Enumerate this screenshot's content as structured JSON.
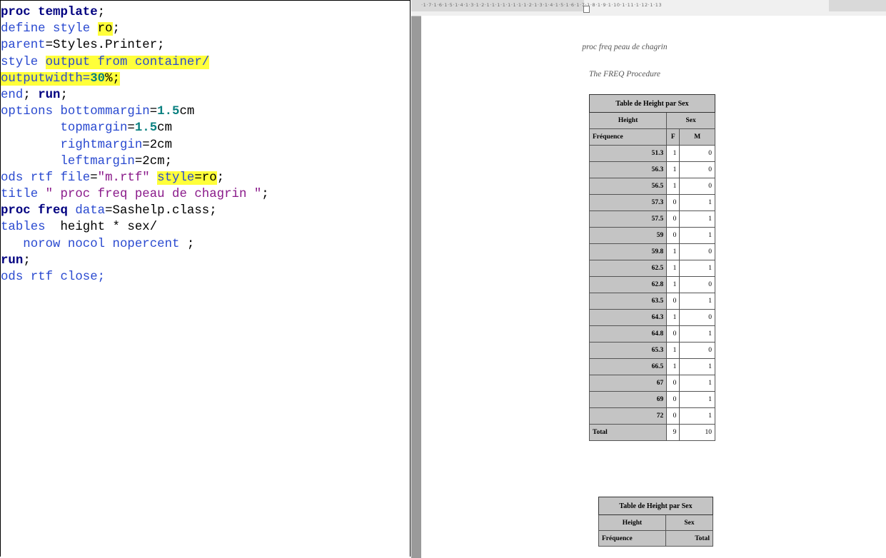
{
  "code": {
    "lines": [
      [
        {
          "t": "proc template",
          "c": "kw"
        },
        {
          "t": ";",
          "c": "bk"
        }
      ],
      [
        {
          "t": "define style ",
          "c": "bl"
        },
        {
          "t": "ro",
          "c": "bk hl"
        },
        {
          "t": ";",
          "c": "bk"
        }
      ],
      [
        {
          "t": "parent",
          "c": "bl"
        },
        {
          "t": "=Styles.Printer;",
          "c": "bk"
        }
      ],
      [
        {
          "t": "style ",
          "c": "bl"
        },
        {
          "t": "output from container/",
          "c": "bl hl"
        }
      ],
      [
        {
          "t": "outputwidth=",
          "c": "bl hl"
        },
        {
          "t": "30",
          "c": "nm hl"
        },
        {
          "t": "%;",
          "c": "bk hl"
        }
      ],
      [
        {
          "t": "end",
          "c": "bl"
        },
        {
          "t": "; ",
          "c": "bk"
        },
        {
          "t": "run",
          "c": "kw"
        },
        {
          "t": ";",
          "c": "bk"
        }
      ],
      [
        {
          "t": "options bottommargin",
          "c": "bl"
        },
        {
          "t": "=",
          "c": "bk"
        },
        {
          "t": "1.5",
          "c": "nm"
        },
        {
          "t": "cm",
          "c": "bk"
        }
      ],
      [
        {
          "t": "        topmargin",
          "c": "bl"
        },
        {
          "t": "=",
          "c": "bk"
        },
        {
          "t": "1.5",
          "c": "nm"
        },
        {
          "t": "cm",
          "c": "bk"
        }
      ],
      [
        {
          "t": "        rightmargin",
          "c": "bl"
        },
        {
          "t": "=2cm",
          "c": "bk"
        }
      ],
      [
        {
          "t": "        leftmargin",
          "c": "bl"
        },
        {
          "t": "=2cm;",
          "c": "bk"
        }
      ],
      [
        {
          "t": "ods rtf file",
          "c": "bl"
        },
        {
          "t": "=",
          "c": "bk"
        },
        {
          "t": "\"m.rtf\"",
          "c": "pu"
        },
        {
          "t": " ",
          "c": "bk"
        },
        {
          "t": "style",
          "c": "bl hl"
        },
        {
          "t": "=ro",
          "c": "bk hl"
        },
        {
          "t": ";",
          "c": "bk"
        }
      ],
      [
        {
          "t": "title ",
          "c": "bl"
        },
        {
          "t": "\" proc freq peau de chagrin \"",
          "c": "pu"
        },
        {
          "t": ";",
          "c": "bk"
        }
      ],
      [
        {
          "t": "proc freq",
          "c": "kw"
        },
        {
          "t": " data",
          "c": "bl"
        },
        {
          "t": "=Sashelp.class;",
          "c": "bk"
        }
      ],
      [
        {
          "t": "tables ",
          "c": "bl"
        },
        {
          "t": " height * sex/",
          "c": "bk"
        }
      ],
      [
        {
          "t": "   norow nocol nopercent ",
          "c": "bl"
        },
        {
          "t": ";",
          "c": "bk"
        }
      ],
      [
        {
          "t": "run",
          "c": "kw"
        },
        {
          "t": ";",
          "c": "bk"
        }
      ],
      [
        {
          "t": "ods rtf close;",
          "c": "bl"
        }
      ]
    ]
  },
  "ruler": {
    "text": "·1·7·1·6·1·5·1·4·1·3·1·2·1·1·1·1·1·1·1·1·2·1·3·1·4·1·5·1·6·1·7·1·8·1·9·1·10·1·11·1·12·1·13"
  },
  "document": {
    "title": "proc freq peau de chagrin",
    "subtitle": "The FREQ Procedure",
    "table1": {
      "caption": "Table de Height par Sex",
      "row_var": "Height",
      "col_var": "Sex",
      "stat_label": "Fréquence",
      "col_levels": [
        "F",
        "M"
      ],
      "rows": [
        {
          "h": "51.3",
          "f": "1",
          "m": "0"
        },
        {
          "h": "56.3",
          "f": "1",
          "m": "0"
        },
        {
          "h": "56.5",
          "f": "1",
          "m": "0"
        },
        {
          "h": "57.3",
          "f": "0",
          "m": "1"
        },
        {
          "h": "57.5",
          "f": "0",
          "m": "1"
        },
        {
          "h": "59",
          "f": "0",
          "m": "1"
        },
        {
          "h": "59.8",
          "f": "1",
          "m": "0"
        },
        {
          "h": "62.5",
          "f": "1",
          "m": "1"
        },
        {
          "h": "62.8",
          "f": "1",
          "m": "0"
        },
        {
          "h": "63.5",
          "f": "0",
          "m": "1"
        },
        {
          "h": "64.3",
          "f": "1",
          "m": "0"
        },
        {
          "h": "64.8",
          "f": "0",
          "m": "1"
        },
        {
          "h": "65.3",
          "f": "1",
          "m": "0"
        },
        {
          "h": "66.5",
          "f": "1",
          "m": "1"
        },
        {
          "h": "67",
          "f": "0",
          "m": "1"
        },
        {
          "h": "69",
          "f": "0",
          "m": "1"
        },
        {
          "h": "72",
          "f": "0",
          "m": "1"
        }
      ],
      "total_label": "Total",
      "total_f": "9",
      "total_m": "10"
    },
    "table2": {
      "caption": "Table de Height par Sex",
      "row_var": "Height",
      "col_var": "Sex",
      "stat_label": "Fréquence",
      "col_total": "Total"
    }
  }
}
